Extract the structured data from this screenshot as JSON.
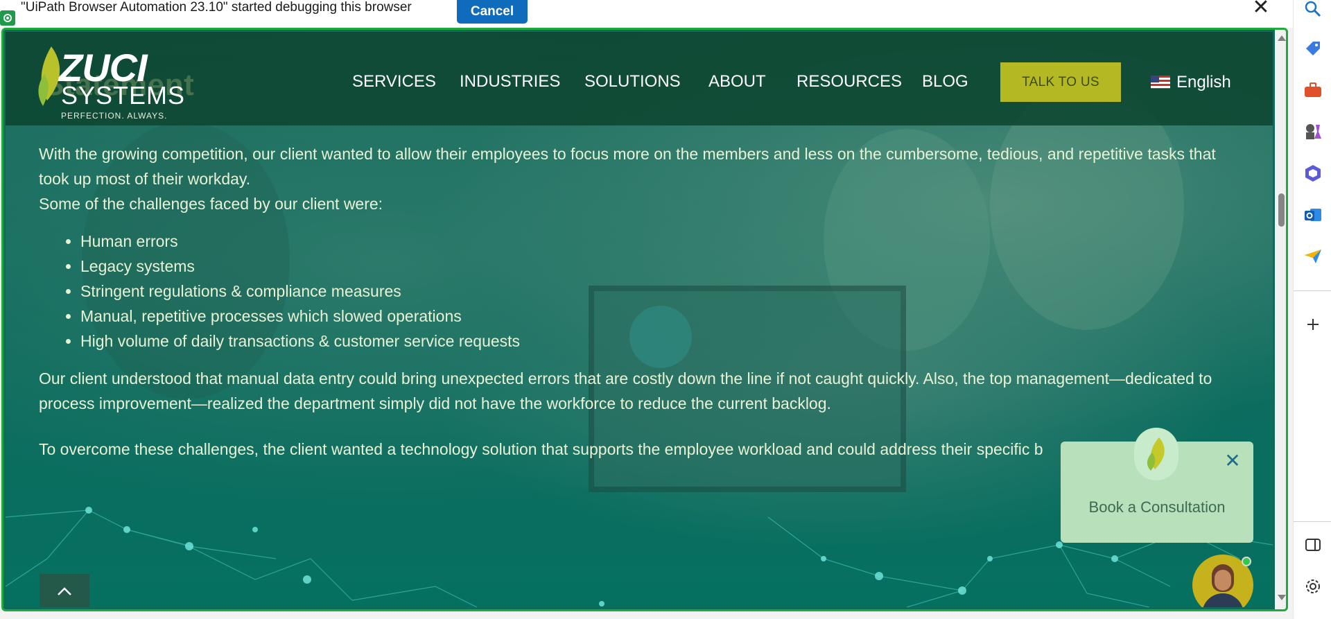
{
  "infobar": {
    "message": "\"UiPath Browser Automation 23.10\" started debugging this browser",
    "cancel_label": "Cancel",
    "close_glyph": "✕"
  },
  "site": {
    "ghost_heading": "Statement",
    "logo": {
      "name": "ZUCI",
      "sub": "SYSTEMS",
      "tagline": "PERFECTION. ALWAYS."
    },
    "nav": [
      "SERVICES",
      "INDUSTRIES",
      "SOLUTIONS",
      "ABOUT",
      "RESOURCES",
      "BLOG"
    ],
    "talk_button": "TALK TO US",
    "language": "English",
    "colors": {
      "header_bg": "#0c4630",
      "talk_button_bg": "#b3b823",
      "text": "#e8f3d6"
    }
  },
  "content": {
    "paragraph1": "With the growing competition, our client wanted to allow their employees to focus more on the members and less on the cumbersome, tedious, and repetitive tasks that took up most of their workday.",
    "paragraph2": "Some of the challenges faced by our client were:",
    "challenges": [
      "Human errors",
      "Legacy systems",
      "Stringent regulations & compliance measures",
      "Manual, repetitive processes which slowed operations",
      "High volume of daily transactions & customer service requests"
    ],
    "paragraph3": "Our client understood that manual data entry could bring unexpected errors that are costly down the line if not caught quickly. Also, the top management—dedicated to process improvement—realized the department simply did not have the workforce to reduce the current backlog.",
    "paragraph4": "To overcome these challenges, the client wanted a technology solution that supports the employee workload and could address their specific b"
  },
  "consultation": {
    "label": "Book a Consultation",
    "close_glyph": "✕"
  },
  "sidebar": {
    "icons": [
      "search-icon",
      "tag-icon",
      "toolbox-icon",
      "games-icon",
      "copilot-icon",
      "outlook-icon",
      "send-icon",
      "add-icon",
      "split-screen-icon",
      "settings-icon"
    ]
  }
}
